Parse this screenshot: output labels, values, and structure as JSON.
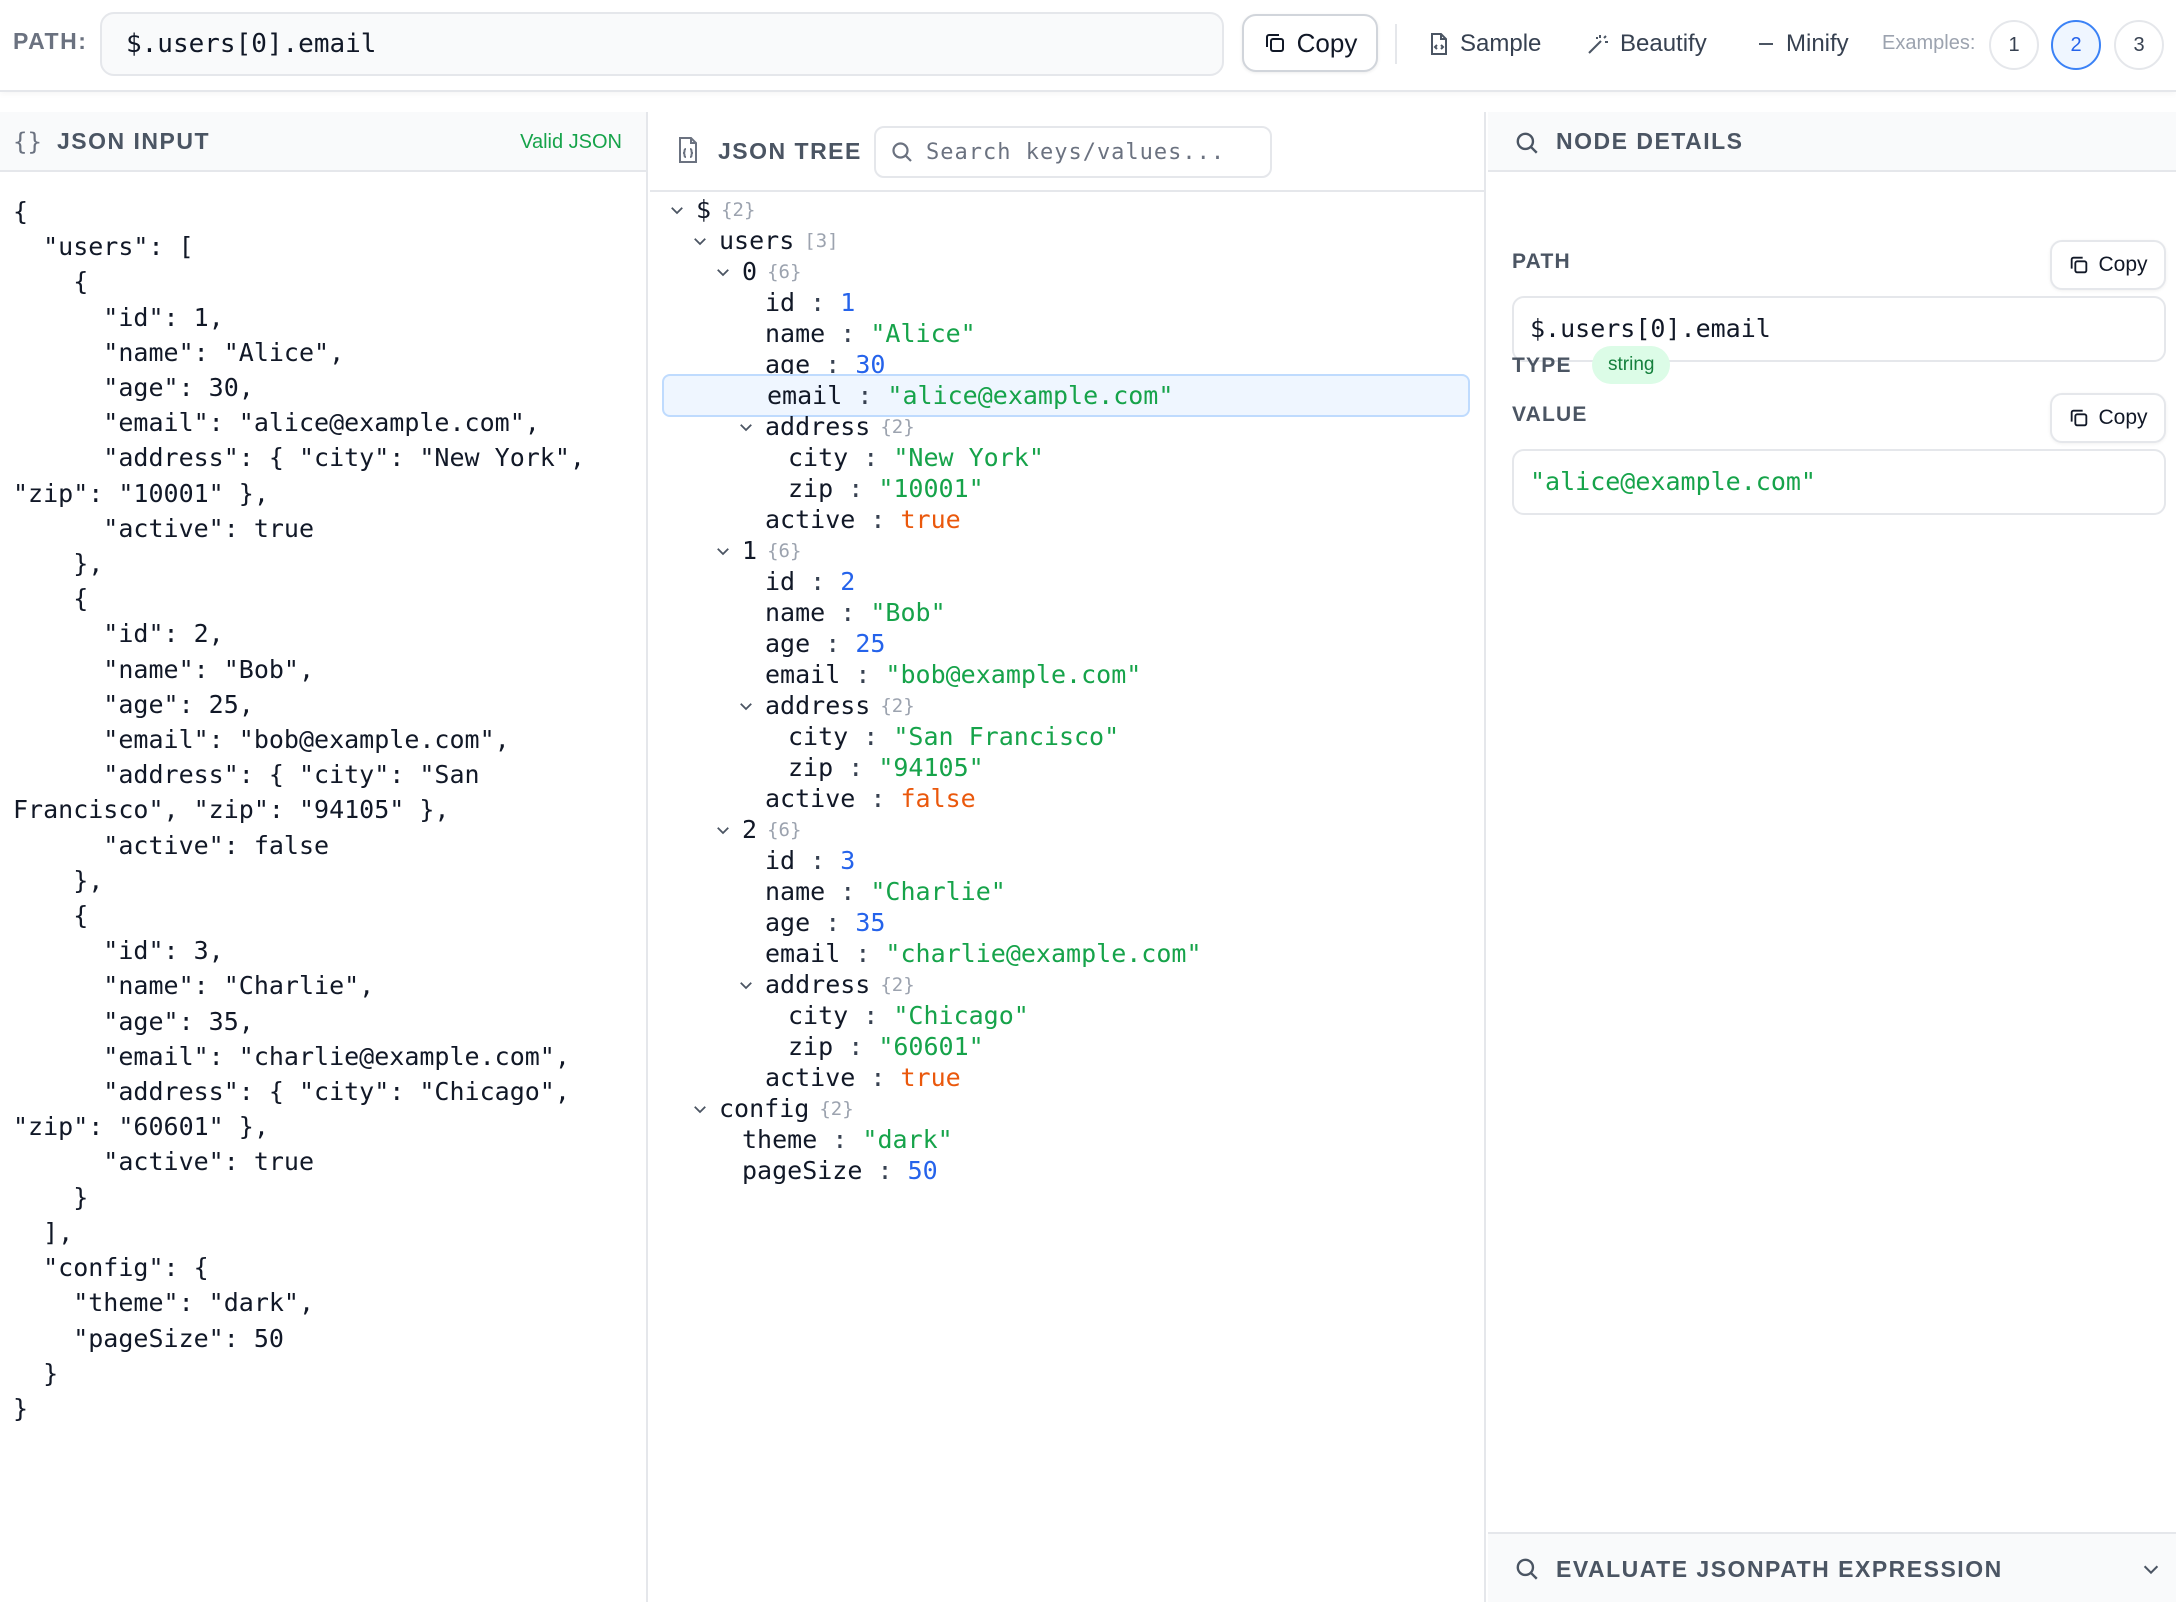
{
  "toolbar": {
    "path_label": "PATH:",
    "path_value": "$.users[0].email",
    "copy_label": "Copy",
    "sample_label": "Sample",
    "beautify_label": "Beautify",
    "minify_label": "Minify",
    "examples_label": "Examples:",
    "examples": [
      "1",
      "2",
      "3"
    ],
    "active_example": "2"
  },
  "input_panel": {
    "title": "JSON INPUT",
    "icon": "{}",
    "status": "Valid JSON",
    "text": "{\n  \"users\": [\n    {\n      \"id\": 1,\n      \"name\": \"Alice\",\n      \"age\": 30,\n      \"email\": \"alice@example.com\",\n      \"address\": { \"city\": \"New York\",\n\"zip\": \"10001\" },\n      \"active\": true\n    },\n    {\n      \"id\": 2,\n      \"name\": \"Bob\",\n      \"age\": 25,\n      \"email\": \"bob@example.com\",\n      \"address\": { \"city\": \"San\nFrancisco\", \"zip\": \"94105\" },\n      \"active\": false\n    },\n    {\n      \"id\": 3,\n      \"name\": \"Charlie\",\n      \"age\": 35,\n      \"email\": \"charlie@example.com\",\n      \"address\": { \"city\": \"Chicago\",\n\"zip\": \"60601\" },\n      \"active\": true\n    }\n  ],\n  \"config\": {\n    \"theme\": \"dark\",\n    \"pageSize\": 50\n  }\n}"
  },
  "tree_panel": {
    "title": "JSON TREE",
    "search_placeholder": "Search keys/values...",
    "nodes": [
      {
        "key": "$",
        "count": "{2}",
        "depth": 0,
        "chevron": true
      },
      {
        "key": "users",
        "count": "[3]",
        "depth": 1,
        "chevron": true
      },
      {
        "key": "0",
        "count": "{6}",
        "depth": 2,
        "chevron": true
      },
      {
        "key": "id",
        "value": "1",
        "vtype": "num",
        "depth": 3
      },
      {
        "key": "name",
        "value": "\"Alice\"",
        "vtype": "str",
        "depth": 3
      },
      {
        "key": "age",
        "value": "30",
        "vtype": "num",
        "depth": 3
      },
      {
        "key": "email",
        "value": "\"alice@example.com\"",
        "vtype": "str",
        "depth": 3,
        "selected": true
      },
      {
        "key": "address",
        "count": "{2}",
        "depth": 3,
        "chevron": true
      },
      {
        "key": "city",
        "value": "\"New York\"",
        "vtype": "str",
        "depth": 4
      },
      {
        "key": "zip",
        "value": "\"10001\"",
        "vtype": "str",
        "depth": 4
      },
      {
        "key": "active",
        "value": "true",
        "vtype": "bool",
        "depth": 3
      },
      {
        "key": "1",
        "count": "{6}",
        "depth": 2,
        "chevron": true
      },
      {
        "key": "id",
        "value": "2",
        "vtype": "num",
        "depth": 3
      },
      {
        "key": "name",
        "value": "\"Bob\"",
        "vtype": "str",
        "depth": 3
      },
      {
        "key": "age",
        "value": "25",
        "vtype": "num",
        "depth": 3
      },
      {
        "key": "email",
        "value": "\"bob@example.com\"",
        "vtype": "str",
        "depth": 3
      },
      {
        "key": "address",
        "count": "{2}",
        "depth": 3,
        "chevron": true
      },
      {
        "key": "city",
        "value": "\"San Francisco\"",
        "vtype": "str",
        "depth": 4
      },
      {
        "key": "zip",
        "value": "\"94105\"",
        "vtype": "str",
        "depth": 4
      },
      {
        "key": "active",
        "value": "false",
        "vtype": "bool",
        "depth": 3
      },
      {
        "key": "2",
        "count": "{6}",
        "depth": 2,
        "chevron": true
      },
      {
        "key": "id",
        "value": "3",
        "vtype": "num",
        "depth": 3
      },
      {
        "key": "name",
        "value": "\"Charlie\"",
        "vtype": "str",
        "depth": 3
      },
      {
        "key": "age",
        "value": "35",
        "vtype": "num",
        "depth": 3
      },
      {
        "key": "email",
        "value": "\"charlie@example.com\"",
        "vtype": "str",
        "depth": 3
      },
      {
        "key": "address",
        "count": "{2}",
        "depth": 3,
        "chevron": true
      },
      {
        "key": "city",
        "value": "\"Chicago\"",
        "vtype": "str",
        "depth": 4
      },
      {
        "key": "zip",
        "value": "\"60601\"",
        "vtype": "str",
        "depth": 4
      },
      {
        "key": "active",
        "value": "true",
        "vtype": "bool",
        "depth": 3
      },
      {
        "key": "config",
        "count": "{2}",
        "depth": 1,
        "chevron": true
      },
      {
        "key": "theme",
        "value": "\"dark\"",
        "vtype": "str",
        "depth": 2
      },
      {
        "key": "pageSize",
        "value": "50",
        "vtype": "num",
        "depth": 2
      }
    ]
  },
  "details_panel": {
    "title": "NODE DETAILS",
    "path_label": "PATH",
    "path_value": "$.users[0].email",
    "copy_label": "Copy",
    "type_label": "TYPE",
    "type_value": "string",
    "value_label": "VALUE",
    "value": "\"alice@example.com\"",
    "eval_label": "EVALUATE JSONPATH EXPRESSION"
  },
  "colors": {
    "accent": "#2563eb",
    "string": "#16a34a",
    "number": "#2563eb",
    "boolean": "#ea580c",
    "selected_bg": "#eff6ff"
  }
}
